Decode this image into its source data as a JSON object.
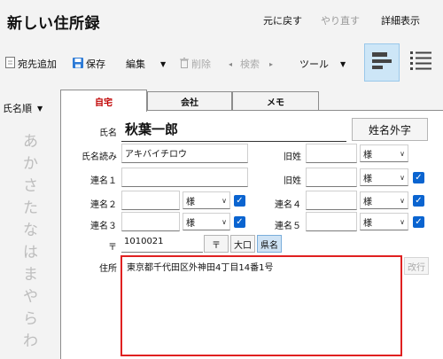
{
  "app": {
    "title": "新しい住所録",
    "undo": "元に戻す",
    "redo": "やり直す",
    "details": "詳細表示"
  },
  "toolbar": {
    "add": "宛先追加",
    "save": "保存",
    "edit": "編集",
    "delete": "削除",
    "search": "検索",
    "tools": "ツール"
  },
  "sidebar": {
    "sort": "氏名順",
    "kana": [
      "あ",
      "か",
      "さ",
      "た",
      "な",
      "は",
      "ま",
      "や",
      "ら",
      "わ"
    ]
  },
  "tabs": [
    "自宅",
    "会社",
    "メモ"
  ],
  "form": {
    "name_label": "氏名",
    "name_value": "秋葉一郎",
    "external_char_button": "姓名外字",
    "reading_label": "氏名読み",
    "reading_value": "アキバイチロウ",
    "old_surname_label": "旧姓",
    "honorific": "様",
    "renmei1_label": "連名１",
    "renmei2_label": "連名２",
    "renmei3_label": "連名３",
    "renmei4_label": "連名４",
    "renmei5_label": "連名５",
    "postal_mark": "〒",
    "postal_value": "1010021",
    "postal_button": "〒",
    "oaza_button": "大口",
    "pref_button": "県名",
    "address_label": "住所",
    "address_value": "東京都千代田区外神田4丁目14番1号",
    "newline_button": "改行"
  },
  "colors": {
    "accent": "#0a64d0",
    "active_tab": "#c00000",
    "highlight": "#e02020"
  }
}
